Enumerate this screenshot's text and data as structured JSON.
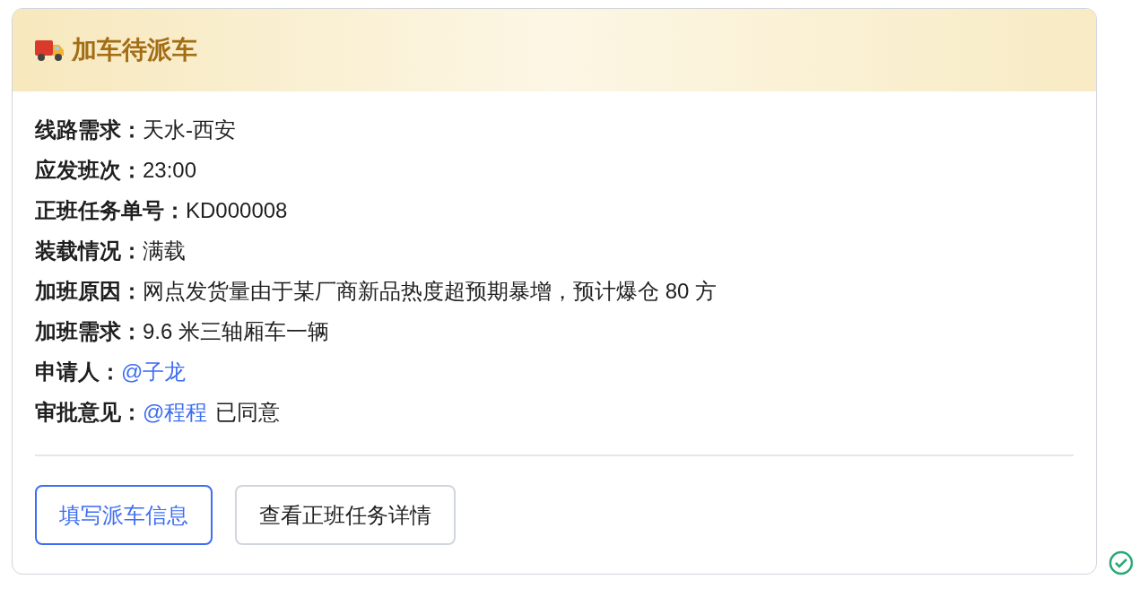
{
  "card": {
    "title": "加车待派车",
    "fields": [
      {
        "label": "线路需求：",
        "value": [
          {
            "kind": "text",
            "text": "天水-西安"
          }
        ]
      },
      {
        "label": "应发班次：",
        "value": [
          {
            "kind": "text",
            "text": "23:00"
          }
        ]
      },
      {
        "label": "正班任务单号：",
        "value": [
          {
            "kind": "text",
            "text": "KD000008"
          }
        ]
      },
      {
        "label": "装载情况：",
        "value": [
          {
            "kind": "text",
            "text": "满载"
          }
        ]
      },
      {
        "label": "加班原因：",
        "value": [
          {
            "kind": "text",
            "text": "网点发货量由于某厂商新品热度超预期暴增，预计爆仓 80 方"
          }
        ]
      },
      {
        "label": "加班需求：",
        "value": [
          {
            "kind": "text",
            "text": "9.6 米三轴厢车一辆"
          }
        ]
      },
      {
        "label": "申请人：",
        "value": [
          {
            "kind": "mention",
            "text": "@子龙"
          }
        ]
      },
      {
        "label": "审批意见：",
        "value": [
          {
            "kind": "mention",
            "text": "@程程"
          },
          {
            "kind": "text",
            "text": "已同意"
          }
        ]
      }
    ],
    "buttons": [
      {
        "label": "填写派车信息",
        "kind": "primary"
      },
      {
        "label": "查看正班任务详情",
        "kind": "default"
      }
    ]
  }
}
